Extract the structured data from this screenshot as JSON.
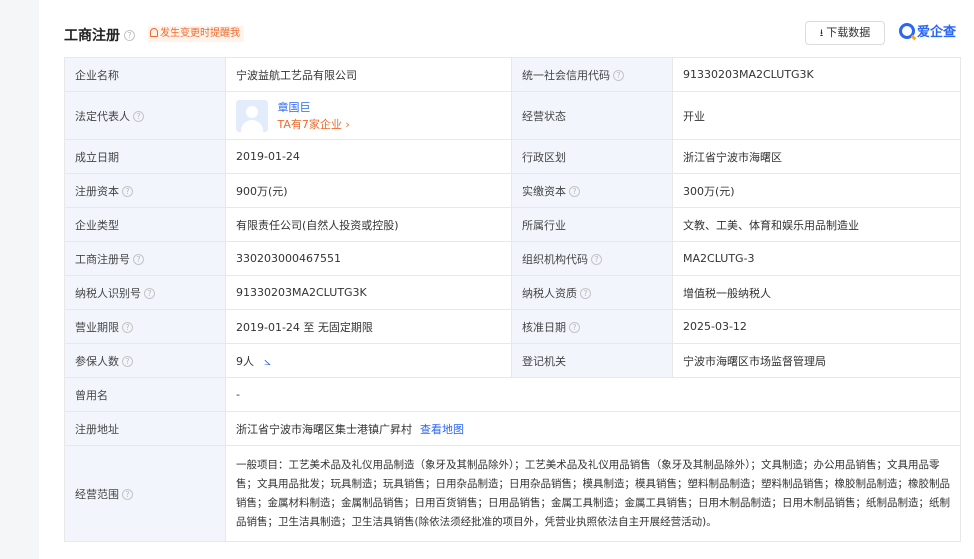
{
  "header": {
    "title": "工商注册",
    "notice": "发生变更时提醒我",
    "download_label": "下载数据",
    "brand": "爱企查"
  },
  "rows": {
    "company_name": {
      "label": "企业名称",
      "value": "宁波益航工艺品有限公司"
    },
    "credit_code": {
      "label": "统一社会信用代码",
      "value": "91330203MA2CLUTG3K"
    },
    "legal_rep": {
      "label": "法定代表人",
      "name": "章国巨",
      "companies": "TA有7家企业"
    },
    "status": {
      "label": "经营状态",
      "value": "开业"
    },
    "founded": {
      "label": "成立日期",
      "value": "2019-01-24"
    },
    "district": {
      "label": "行政区划",
      "value": "浙江省宁波市海曙区"
    },
    "registered_capital": {
      "label": "注册资本",
      "value": "900万(元)"
    },
    "paid_capital": {
      "label": "实缴资本",
      "value": "300万(元)"
    },
    "company_type": {
      "label": "企业类型",
      "value": "有限责任公司(自然人投资或控股)"
    },
    "industry": {
      "label": "所属行业",
      "value": "文教、工美、体育和娱乐用品制造业"
    },
    "reg_number": {
      "label": "工商注册号",
      "value": "330203000467551"
    },
    "org_code": {
      "label": "组织机构代码",
      "value": "MA2CLUTG-3"
    },
    "taxpayer_id": {
      "label": "纳税人识别号",
      "value": "91330203MA2CLUTG3K"
    },
    "taxpayer_qual": {
      "label": "纳税人资质",
      "value": "增值税一般纳税人"
    },
    "term": {
      "label": "营业期限",
      "value": "2019-01-24 至 无固定期限"
    },
    "approval_date": {
      "label": "核准日期",
      "value": "2025-03-12"
    },
    "insured": {
      "label": "参保人数",
      "value": "9人"
    },
    "authority": {
      "label": "登记机关",
      "value": "宁波市海曙区市场监督管理局"
    },
    "former_name": {
      "label": "曾用名",
      "value": "-"
    },
    "address": {
      "label": "注册地址",
      "value": "浙江省宁波市海曙区集士港镇广昇村",
      "map_link": "查看地图"
    },
    "scope": {
      "label": "经营范围",
      "value": "一般项目：工艺美术品及礼仪用品制造（象牙及其制品除外）；工艺美术品及礼仪用品销售（象牙及其制品除外）；文具制造；办公用品销售；文具用品零售；文具用品批发；玩具制造；玩具销售；日用杂品制造；日用杂品销售；模具制造；模具销售；塑料制品制造；塑料制品销售；橡胶制品制造；橡胶制品销售；金属材料制造；金属制品销售；日用百货销售；日用品销售；金属工具制造；金属工具销售；日用木制品制造；日用木制品销售；纸制品制造；纸制品销售；卫生洁具制造；卫生洁具销售(除依法须经批准的项目外，凭营业执照依法自主开展经营活动)。"
    }
  },
  "colors": {
    "accent": "#2a66f6",
    "warn": "#f06a2b",
    "label_bg": "#f2f6fc"
  }
}
